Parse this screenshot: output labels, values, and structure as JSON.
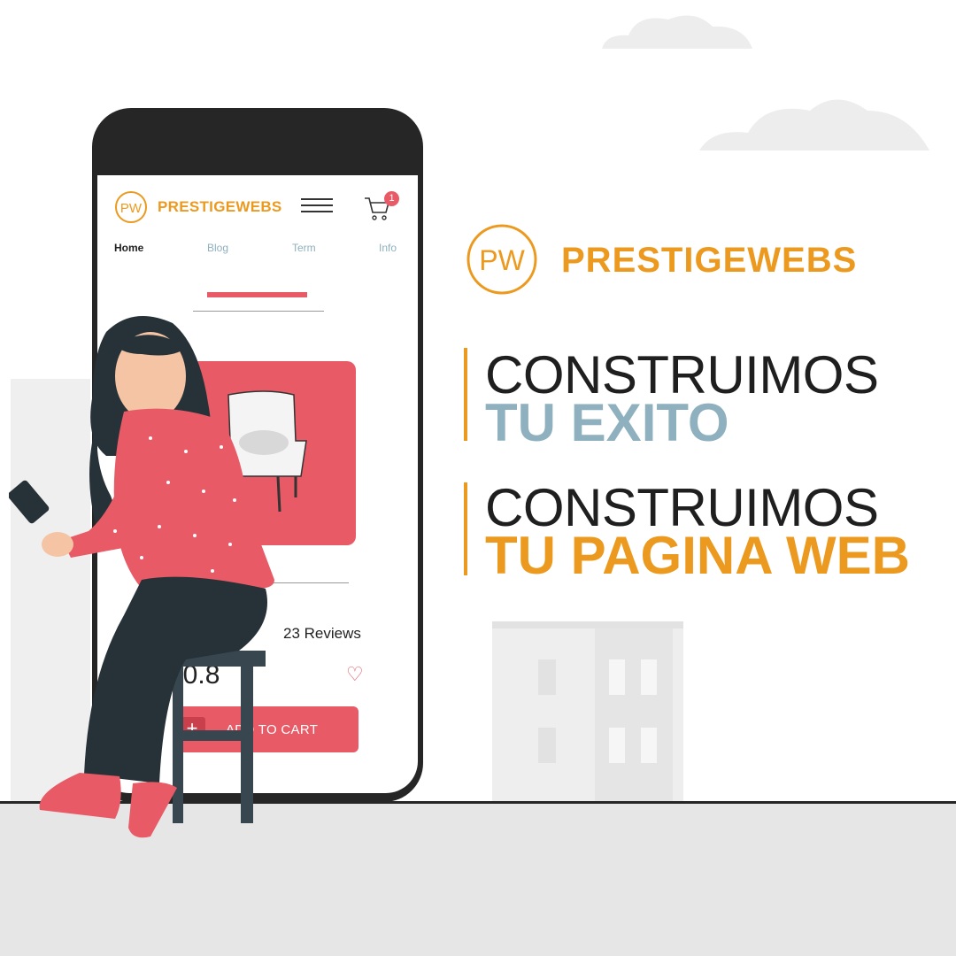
{
  "colors": {
    "accent_orange": "#ec9a1f",
    "accent_red": "#e85a66",
    "muted_blue": "#8fb0be",
    "dark": "#262626",
    "ground": "#e6e6e6"
  },
  "phone_app": {
    "logo_monogram": "PW",
    "brand": "PRESTIGEWEBS",
    "cart_count": "1",
    "nav": [
      {
        "label": "Home",
        "active": true
      },
      {
        "label": "Blog",
        "active": false
      },
      {
        "label": "Term",
        "active": false
      },
      {
        "label": "Info",
        "active": false
      }
    ],
    "product": {
      "reviews": "23 Reviews",
      "price": "40.8",
      "add_to_cart": "ADD TO CART"
    }
  },
  "brand": {
    "monogram": "PW",
    "name": "PRESTIGEWEBS"
  },
  "headlines": [
    {
      "line1": "CONSTRUIMOS",
      "line2": "TU EXITO"
    },
    {
      "line1": "CONSTRUIMOS",
      "line2": "TU PAGINA WEB"
    }
  ],
  "icons": [
    "cart-icon",
    "menu-icon",
    "heart-icon",
    "plus-icon",
    "phone-device-icon"
  ]
}
